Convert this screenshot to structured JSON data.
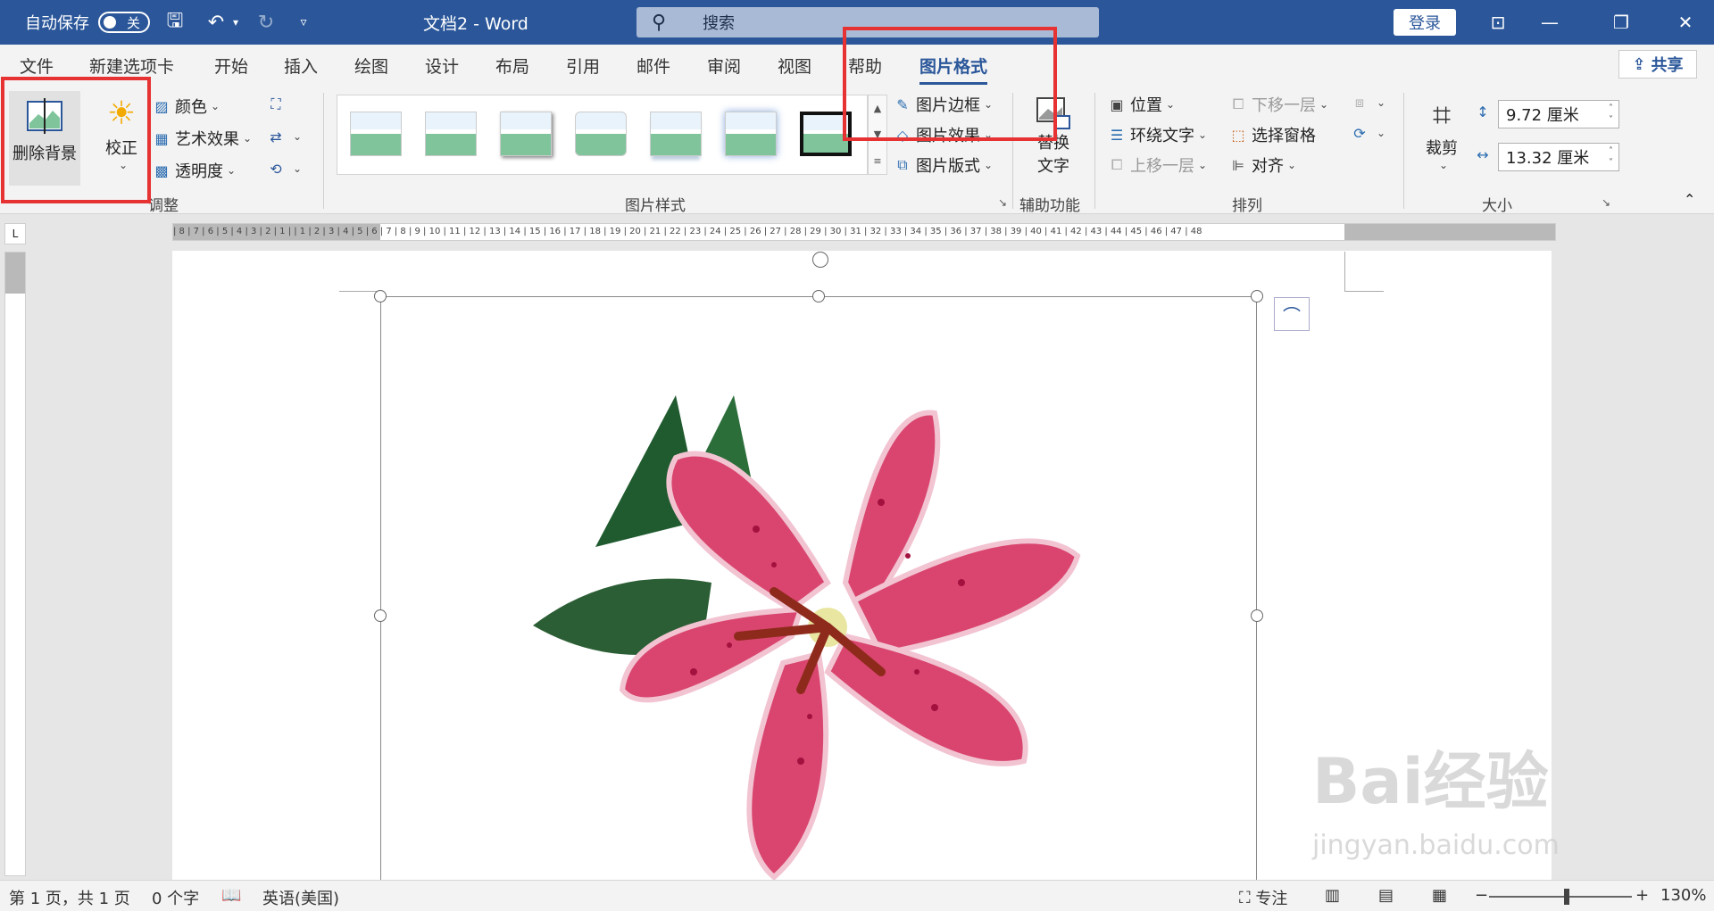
{
  "titlebar": {
    "autosave_label": "自动保存",
    "autosave_state": "关",
    "doc_title": "文档2  -  Word",
    "search_placeholder": "搜索",
    "login": "登录"
  },
  "tabs": [
    {
      "label": "文件"
    },
    {
      "label": "新建选项卡"
    },
    {
      "label": "开始"
    },
    {
      "label": "插入"
    },
    {
      "label": "绘图"
    },
    {
      "label": "设计"
    },
    {
      "label": "布局"
    },
    {
      "label": "引用"
    },
    {
      "label": "邮件"
    },
    {
      "label": "审阅"
    },
    {
      "label": "视图"
    },
    {
      "label": "帮助"
    },
    {
      "label": "图片格式"
    }
  ],
  "share": "共享",
  "ribbon": {
    "adjust": {
      "remove_bg": "删除背景",
      "correct": "校正",
      "color": "颜色",
      "artistic": "艺术效果",
      "transparency": "透明度",
      "group_label": "调整"
    },
    "styles": {
      "border": "图片边框",
      "effects": "图片效果",
      "layout": "图片版式",
      "group_label": "图片样式"
    },
    "accessibility": {
      "alt_text_line1": "替换",
      "alt_text_line2": "文字",
      "group_label": "辅助功能"
    },
    "arrange": {
      "position": "位置",
      "wrap": "环绕文字",
      "forward": "上移一层",
      "backward": "下移一层",
      "selection_pane": "选择窗格",
      "align": "对齐",
      "group_label": "排列"
    },
    "size": {
      "crop": "裁剪",
      "height": "9.72 厘米",
      "width": "13.32 厘米",
      "group_label": "大小"
    }
  },
  "ruler": {
    "ticks": "| 8 | 7 | 6 | 5 | 4 | 3 | 2 | 1 |   | 1 | 2 | 3 | 4 | 5 | 6 | 7 | 8 | 9 | 10 | 11 | 12 | 13 | 14 | 15 | 16 | 17 | 18 | 19 | 20 | 21 | 22 | 23 | 24 | 25 | 26 | 27 | 28 | 29 | 30 | 31 | 32 | 33 | 34 | 35 | 36 | 37 | 38 | 39 | 40 | 41 | 42 | 43 | 44 | 45 | 46 | 47 | 48"
  },
  "statusbar": {
    "page": "第 1 页，共 1 页",
    "words": "0 个字",
    "language": "英语(美国)",
    "focus": "专注",
    "zoom": "130%"
  },
  "watermark": {
    "brand": "Bai经验",
    "url": "jingyan.baidu.com"
  },
  "colors": {
    "titlebar": "#2b579a",
    "highlight": "#e63232"
  }
}
